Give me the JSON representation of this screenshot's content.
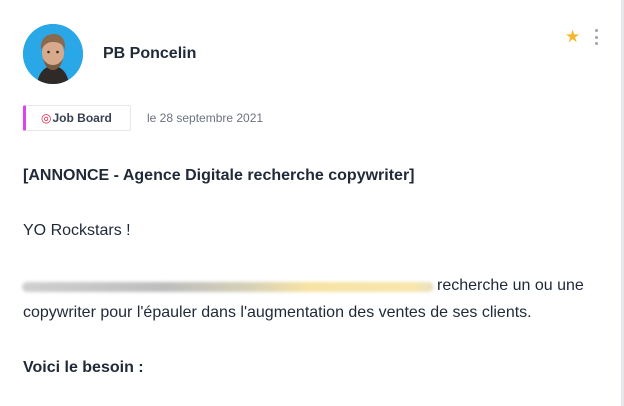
{
  "post": {
    "author": "PB Poncelin",
    "tag_label": "Job Board",
    "date": "le 28 septembre 2021",
    "title": "[ANNONCE - Agence Digitale recherche copywriter]",
    "greeting": "YO Rockstars !",
    "line1_tail": "recherche un ou une",
    "line2": "copywriter pour l'épauler dans l'augmentation des ventes de ses clients.",
    "need_heading": "Voici le besoin :"
  },
  "colors": {
    "avatar_bg": "#2aa7e6",
    "star": "#f5b82e",
    "tag_accent": "#d946ef"
  },
  "icons": {
    "star": "star-icon",
    "menu": "kebab-menu-icon",
    "tag": "dart-target-icon"
  }
}
